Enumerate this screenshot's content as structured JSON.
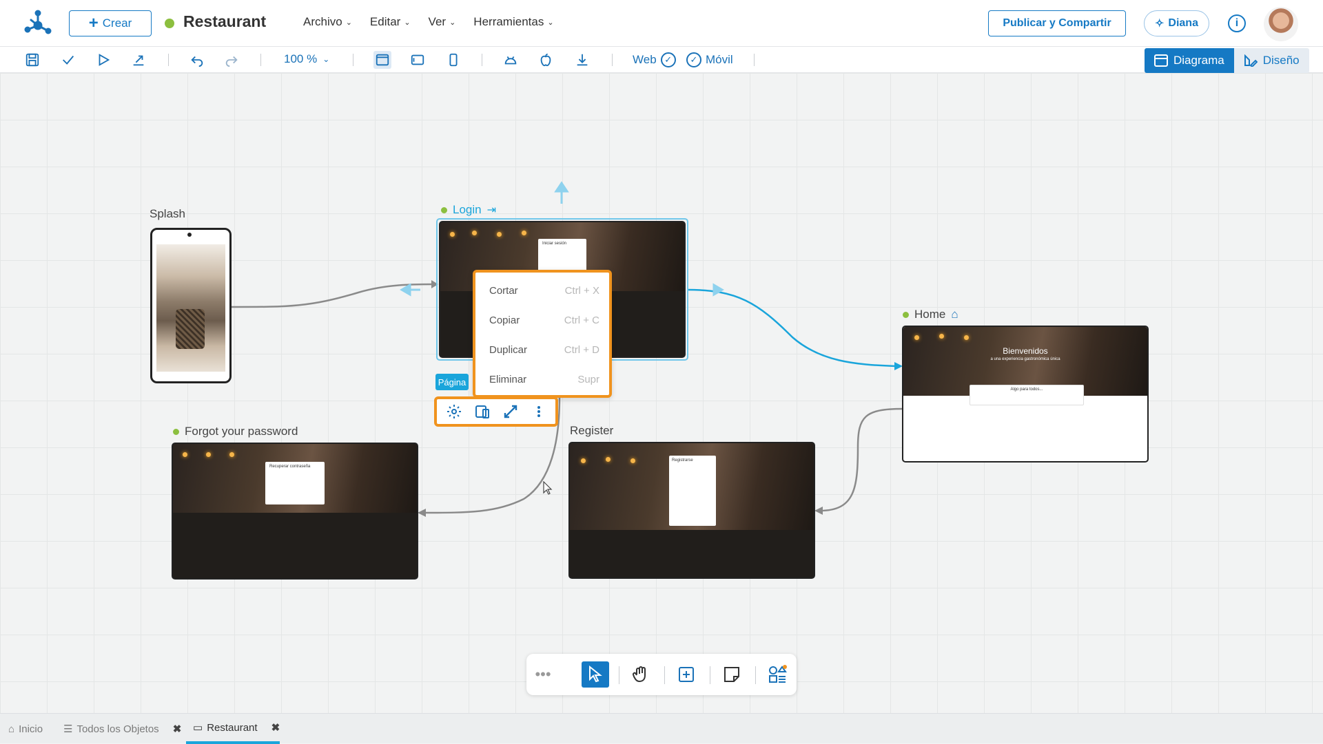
{
  "header": {
    "create_label": "Crear",
    "app_title": "Restaurant",
    "menu": [
      {
        "label": "Archivo"
      },
      {
        "label": "Editar"
      },
      {
        "label": "Ver"
      },
      {
        "label": "Herramientas"
      }
    ],
    "publish_label": "Publicar y Compartir",
    "assistant_label": "Diana",
    "status_color": "#8cbf3f",
    "accent_color": "#1579c4"
  },
  "toolbar": {
    "zoom": "100 %",
    "web_label": "Web",
    "mobile_label": "Móvil",
    "view_diagram": "Diagrama",
    "view_design": "Diseño"
  },
  "pages": {
    "splash": {
      "name": "Splash"
    },
    "login": {
      "name": "Login",
      "card_title": "Iniciar sesión"
    },
    "home": {
      "name": "Home",
      "hero_title": "Bienvenidos",
      "hero_sub": "a una experiencia gastronómica única",
      "section_title": "Algo para todos..."
    },
    "forgot": {
      "name": "Forgot your password",
      "card_title": "Recuperar contraseña"
    },
    "register": {
      "name": "Register",
      "card_title": "Registrarse"
    }
  },
  "context_menu": {
    "items": [
      {
        "label": "Cortar",
        "shortcut": "Ctrl + X"
      },
      {
        "label": "Copiar",
        "shortcut": "Ctrl + C"
      },
      {
        "label": "Duplicar",
        "shortcut": "Ctrl + D"
      },
      {
        "label": "Eliminar",
        "shortcut": "Supr"
      }
    ],
    "highlight_color": "#f0931e"
  },
  "selection": {
    "tag": "Página"
  },
  "tabs": [
    {
      "label": "Inicio",
      "icon": "home-icon"
    },
    {
      "label": "Todos los Objetos",
      "icon": "list-icon"
    },
    {
      "label": "Restaurant",
      "icon": "folder-icon"
    }
  ]
}
